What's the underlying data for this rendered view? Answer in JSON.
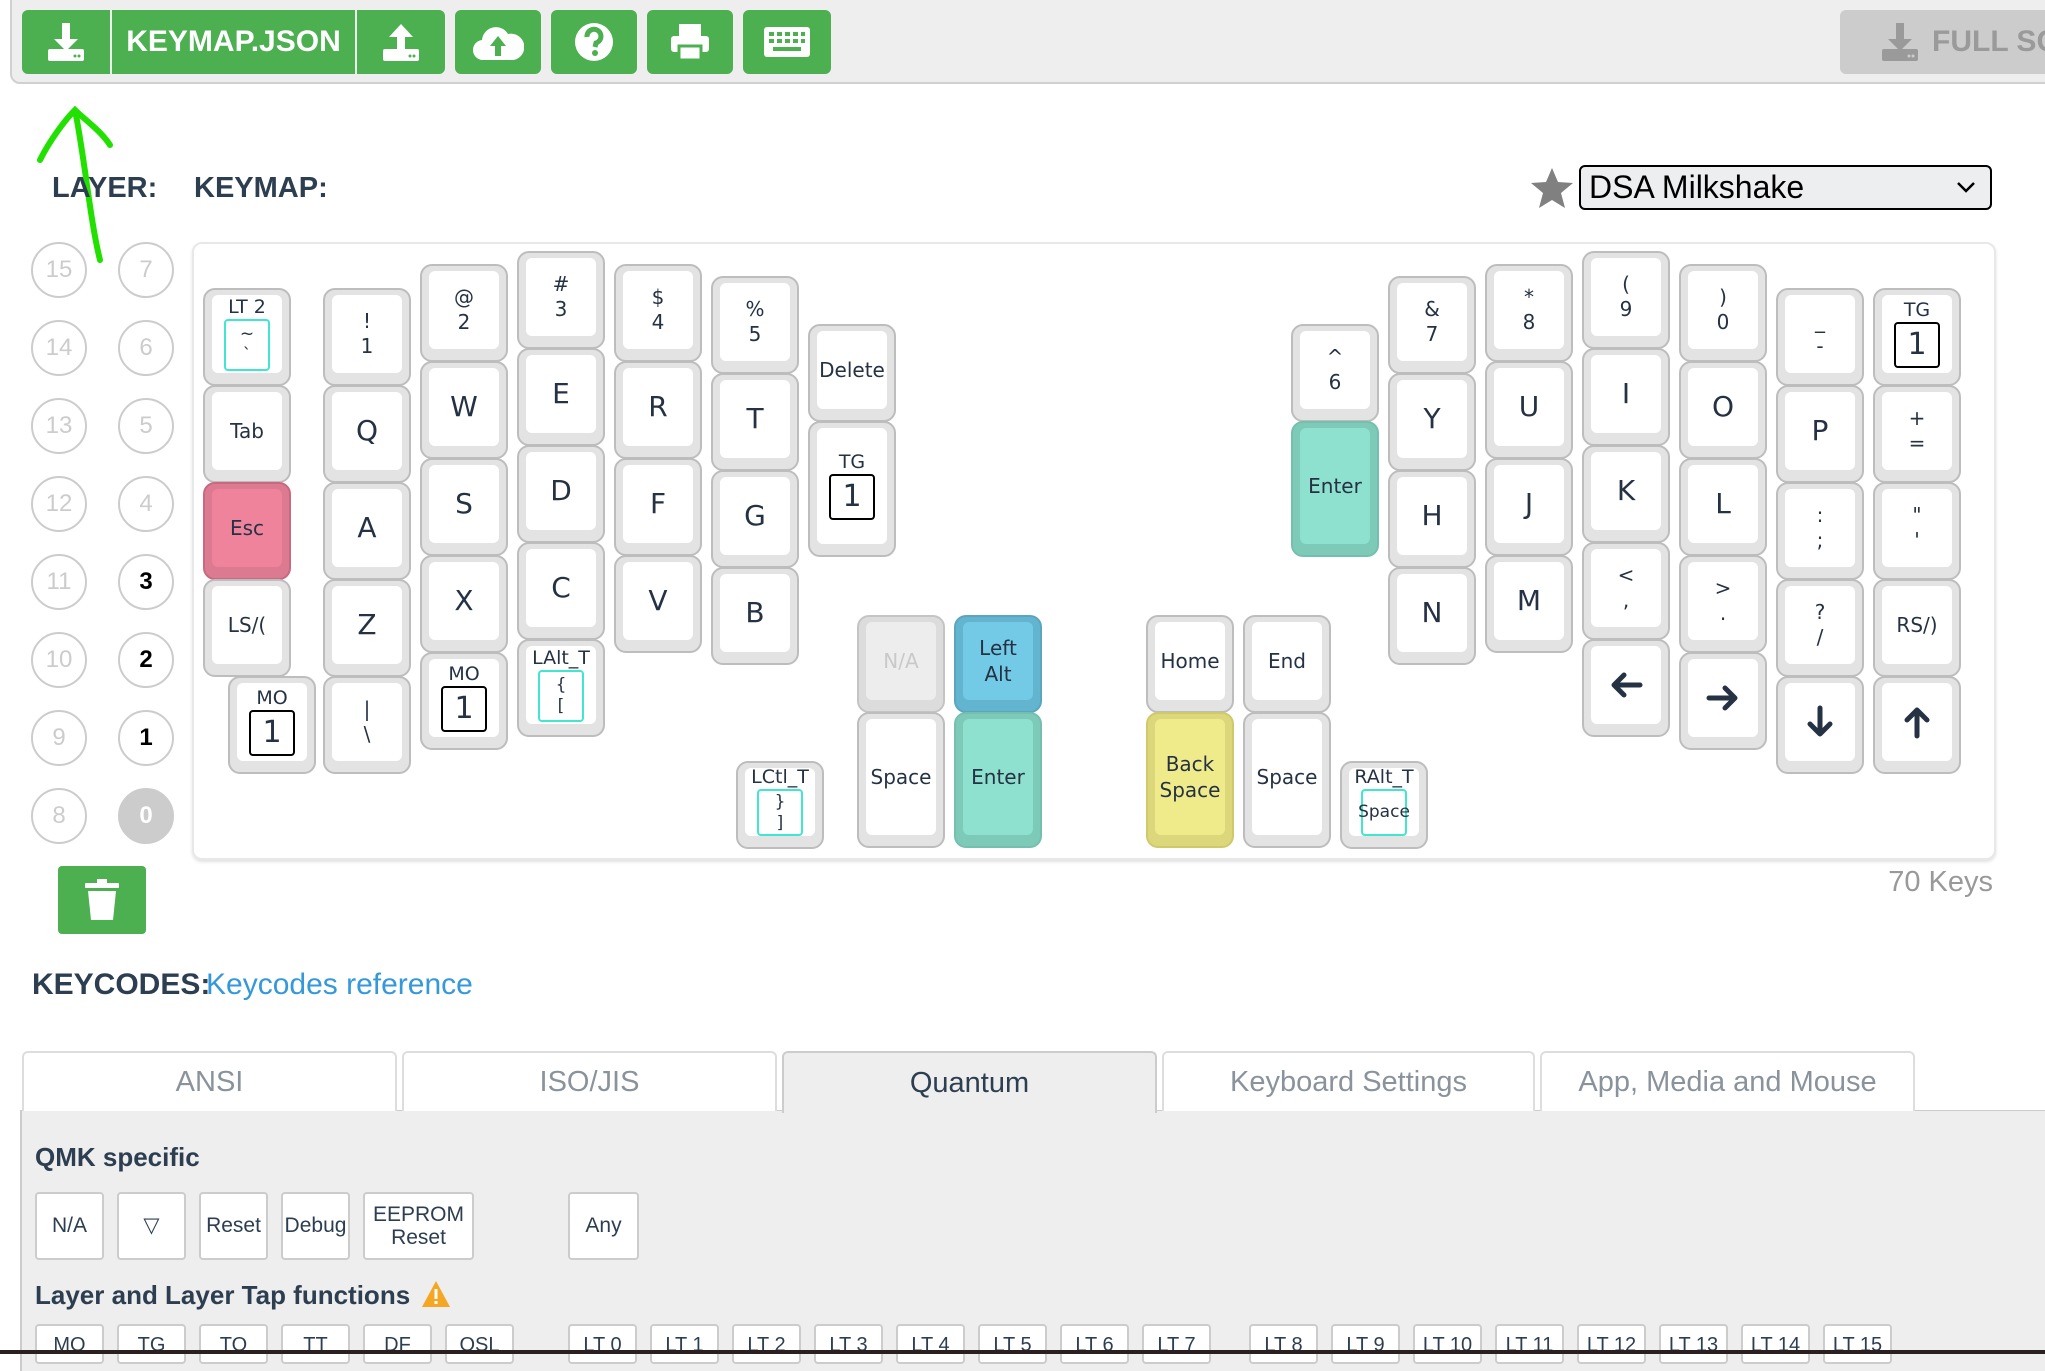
{
  "toolbar": {
    "download_icon": "download-icon",
    "keymap_json_label": "KEYMAP.JSON",
    "upload_icon": "upload-icon",
    "cloud_upload_icon": "cloud-upload-icon",
    "help_icon": "question-circle-icon",
    "print_icon": "print-icon",
    "keyboard_icon": "keyboard-icon",
    "full_screen_label": "FULL SC"
  },
  "layer": {
    "label": "LAYER:",
    "active": 0,
    "used": [
      1,
      2,
      3
    ],
    "buttons_left": [
      "15",
      "14",
      "13",
      "12",
      "11",
      "10",
      "9",
      "8"
    ],
    "buttons_right": [
      "7",
      "6",
      "5",
      "4",
      "3",
      "2",
      "1",
      "0"
    ]
  },
  "keymap": {
    "label": "KEYMAP:",
    "theme_select": "DSA Milkshake",
    "key_count": "70 Keys"
  },
  "accent_color": "#4caf50",
  "keys": {
    "lt2": {
      "top": "LT 2",
      "inner": "~\n`"
    },
    "n1": "!\n1",
    "n2": "@\n2",
    "n3": "#\n3",
    "n4": "$\n4",
    "n5": "%\n5",
    "delete": "Delete",
    "tab": "Tab",
    "q": "Q",
    "w": "W",
    "e": "E",
    "r": "R",
    "t": "T",
    "tg_left": {
      "top": "TG",
      "inner": "1"
    },
    "esc": "Esc",
    "a": "A",
    "s": "S",
    "d": "D",
    "f": "F",
    "g": "G",
    "lshift": "LS/(",
    "z": "Z",
    "x": "X",
    "c": "C",
    "v": "V",
    "b": "B",
    "mo_left1": {
      "top": "MO",
      "inner": "1"
    },
    "backslash": "|\n\\",
    "mo_left2": {
      "top": "MO",
      "inner": "1"
    },
    "lalt_t": {
      "top": "LAlt_T",
      "inner": "{\n["
    },
    "na": "N/A",
    "left_alt": "Left Alt",
    "lctl_t": {
      "top": "LCtl_T",
      "inner": "}\n]"
    },
    "space_l": "Space",
    "enter_l": "Enter",
    "home": "Home",
    "end": "End",
    "backspace": "Back\nSpace",
    "space_r": "Space",
    "ralt_t": {
      "top": "RAlt_T",
      "inner": "Space"
    },
    "n6": "^\n6",
    "n7": "&\n7",
    "n8": "*\n8",
    "n9": "(\n9",
    "n0": ")\n0",
    "minus": "_\n-",
    "tg_right": {
      "top": "TG",
      "inner": "1"
    },
    "enter_r": "Enter",
    "y": "Y",
    "u": "U",
    "i": "I",
    "o": "O",
    "p": "P",
    "equal": "+\n=",
    "h": "H",
    "j": "J",
    "k": "K",
    "l": "L",
    "semicolon": ":\n;",
    "quote": "\"\n'",
    "n": "N",
    "m": "M",
    "comma": "<\n,",
    "period": ">\n.",
    "slash": "?\n/",
    "rshift": "RS/)",
    "left": "left-arrow-icon",
    "right": "right-arrow-icon",
    "down": "down-arrow-icon",
    "up": "up-arrow-icon"
  },
  "keycodes": {
    "label": "KEYCODES:",
    "reference_link": "Keycodes reference",
    "tabs": [
      "ANSI",
      "ISO/JIS",
      "Quantum",
      "Keyboard Settings",
      "App, Media and Mouse"
    ],
    "active_tab": "Quantum",
    "qmk_title": "QMK specific",
    "qmk": [
      "N/A",
      "▽",
      "Reset",
      "Debug",
      "EEPROM\nReset",
      "Any"
    ],
    "layer_title": "Layer and Layer Tap functions",
    "layer_fns": [
      "MO",
      "TG",
      "TO",
      "TT",
      "DF",
      "OSL"
    ],
    "lt": [
      "LT 0",
      "LT 1",
      "LT 2",
      "LT 3",
      "LT 4",
      "LT 5",
      "LT 6",
      "LT 7",
      "LT 8",
      "LT 9",
      "LT 10",
      "LT 11",
      "LT 12",
      "LT 13",
      "LT 14",
      "LT 15"
    ]
  }
}
